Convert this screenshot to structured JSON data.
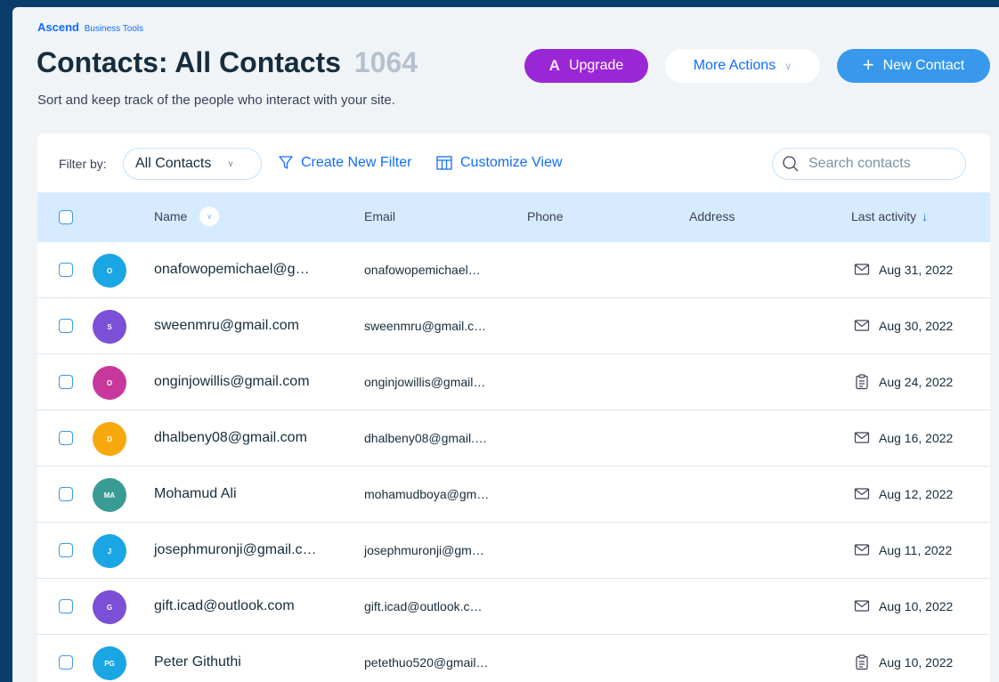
{
  "brand": {
    "name": "Ascend",
    "sub": "Business Tools"
  },
  "header": {
    "title": "Contacts: All Contacts",
    "count": "1064",
    "subtitle": "Sort and keep track of the people who interact with your site."
  },
  "actions": {
    "upgrade_glyph": "A",
    "upgrade_label": "Upgrade",
    "more_label": "More Actions",
    "new_label": "New Contact"
  },
  "filter": {
    "label": "Filter by:",
    "selected": "All Contacts",
    "create_label": "Create New Filter",
    "customize_label": "Customize View",
    "search_placeholder": "Search contacts"
  },
  "table": {
    "columns": {
      "name": "Name",
      "email": "Email",
      "phone": "Phone",
      "address": "Address",
      "last_activity": "Last activity"
    },
    "rows": [
      {
        "initials": "O",
        "color": "#1aa6e4",
        "name": "onafowopemichael@g…",
        "email": "onafowopemichael…",
        "activity_icon": "mail-icon",
        "date": "Aug 31, 2022"
      },
      {
        "initials": "S",
        "color": "#7b4fd6",
        "name": "sweenmru@gmail.com",
        "email": "sweenmru@gmail.c…",
        "activity_icon": "mail-icon",
        "date": "Aug 30, 2022"
      },
      {
        "initials": "O",
        "color": "#c8389c",
        "name": "onginjowillis@gmail.com",
        "email": "onginjowillis@gmail…",
        "activity_icon": "clipboard-icon",
        "date": "Aug 24, 2022"
      },
      {
        "initials": "D",
        "color": "#f7a80d",
        "name": "dhalbeny08@gmail.com",
        "email": "dhalbeny08@gmail.…",
        "activity_icon": "mail-icon",
        "date": "Aug 16, 2022"
      },
      {
        "initials": "MA",
        "color": "#3a9b95",
        "name": "Mohamud Ali",
        "email": "mohamudboya@gm…",
        "activity_icon": "mail-icon",
        "date": "Aug 12, 2022"
      },
      {
        "initials": "J",
        "color": "#1aa6e4",
        "name": "josephmuronji@gmail.c…",
        "email": "josephmuronji@gm…",
        "activity_icon": "mail-icon",
        "date": "Aug 11, 2022"
      },
      {
        "initials": "G",
        "color": "#7b4fd6",
        "name": "gift.icad@outlook.com",
        "email": "gift.icad@outlook.c…",
        "activity_icon": "mail-icon",
        "date": "Aug 10, 2022"
      },
      {
        "initials": "PG",
        "color": "#1aa6e4",
        "name": "Peter Githuthi",
        "email": "petethuo520@gmail…",
        "activity_icon": "clipboard-icon",
        "date": "Aug 10, 2022"
      }
    ]
  }
}
